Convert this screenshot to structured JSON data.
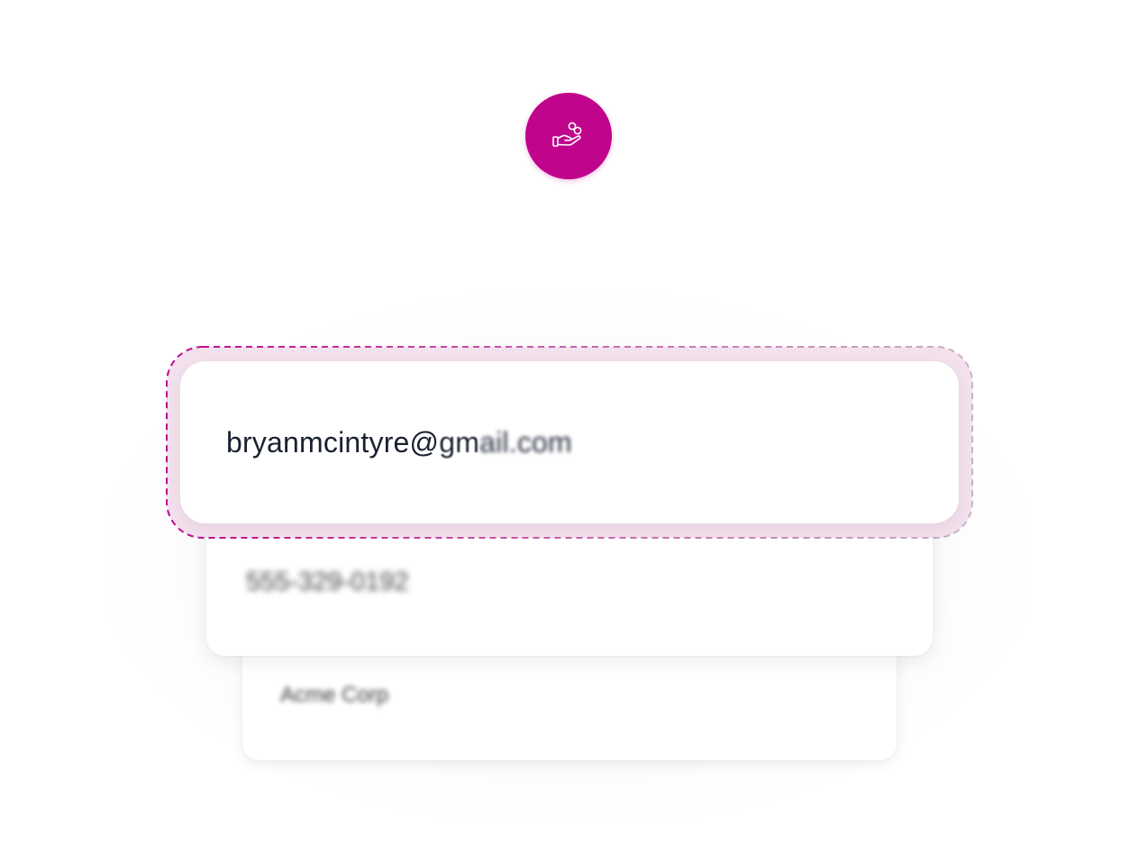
{
  "badge": {
    "icon": "hand-coins-icon",
    "color": "#c0058c"
  },
  "cards": {
    "front": {
      "email_part1": "bryanmcintyre@",
      "email_part2": "gm",
      "email_part3": "ail.com"
    },
    "middle": {
      "phone": "555-329-0192"
    },
    "back": {
      "company": "Acme Corp"
    }
  },
  "colors": {
    "accent": "#c0058c",
    "focus_ring_fill": "#f3e2ee",
    "text": "#1a2030"
  }
}
